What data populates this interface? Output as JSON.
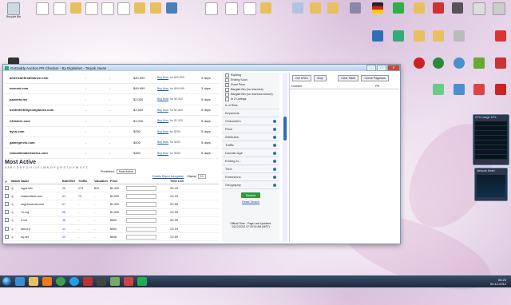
{
  "desktop_icons_top": [
    "Recycle Bin",
    "",
    "",
    "",
    "",
    "",
    "",
    "",
    "",
    "",
    "",
    "",
    "",
    "",
    "",
    "",
    "",
    "",
    "",
    "",
    "",
    "",
    "",
    "",
    "",
    ""
  ],
  "desktop_icons_right": [
    "",
    "",
    "",
    "",
    "",
    "",
    "",
    "",
    "",
    "",
    ""
  ],
  "window": {
    "title": "GoDaddy Auction PR Checker - By Digitalnet - Taryak Javan",
    "min": "–",
    "max": "□",
    "close": "✕"
  },
  "top_rows": [
    {
      "domain": "americanfirstfinance.com",
      "a": "-",
      "b": "-",
      "price": "$40,500",
      "bid": "Buy Now",
      "bidval": "for $40,500",
      "len": "3 days"
    },
    {
      "domain": "moncai.com",
      "a": "-",
      "b": "-",
      "price": "$49,999",
      "bid": "Buy Now",
      "bidval": "for $49,999",
      "len": "3 days"
    },
    {
      "domain": "pandeta.me",
      "a": "-",
      "b": "-",
      "price": "$2,000",
      "bid": "Buy Now",
      "bidval": "for $2,000",
      "len": "5 days"
    },
    {
      "domain": "bestinfertilitycompanies.com",
      "a": "-",
      "b": "-",
      "price": "$1,500",
      "bid": "Buy Now",
      "bidval": "for $1,500",
      "len": "5 days"
    },
    {
      "domain": "234store.com",
      "a": "-",
      "b": "-",
      "price": "$1,000",
      "bid": "Buy Now",
      "bidval": "for $1,000",
      "len": "5 days"
    },
    {
      "domain": "ayco.com",
      "a": "-",
      "b": "-",
      "price": "$250",
      "bid": "Buy Now",
      "bidval": "for $250",
      "len": "5 days"
    },
    {
      "domain": "gamegervis.com",
      "a": "-",
      "b": "-",
      "price": "$400",
      "bid": "Buy Now",
      "bidval": "for $400",
      "len": "5 days"
    },
    {
      "domain": "educationalelectrics.com",
      "a": "-",
      "b": "-",
      "price": "$450",
      "bid": "Buy Now",
      "bidval": "for $450",
      "len": "5 days"
    }
  ],
  "most_active": {
    "title": "Most Active",
    "alphabet": "# A B C D E F G H I J K L M N O P Q R S T U V W X Y Z",
    "pagination": "Enable Reject Navigation",
    "predefined_label": "Predefined:",
    "predefined_value": "Most Active",
    "display_label": "Display",
    "display_value": "10",
    "headers": [
      "Watch",
      "Name",
      "Bid/Offer",
      "Traffic",
      "Valuation",
      "Price",
      "Time Left"
    ],
    "rows": [
      {
        "name": "nqpa.info",
        "bo": "98",
        "tr": "174",
        "va": "$10",
        "pr": "$2,400",
        "tl": "3D 4H"
      },
      {
        "name": "madecriticer.com",
        "bo": "83",
        "tr": "73",
        "va": "-",
        "pr": "$2,050",
        "tl": "1D 2H"
      },
      {
        "name": "ungzhousnas.com",
        "bo": "67",
        "tr": "-",
        "va": "-",
        "pr": "$1,300",
        "tl": "2D 8H"
      },
      {
        "name": "7u.org",
        "bo": "56",
        "tr": "-",
        "va": "-",
        "pr": "$1,500",
        "tl": "1D 5H"
      },
      {
        "name": "3.net",
        "bo": "46",
        "tr": "-",
        "va": "-",
        "pr": "$650",
        "tl": "3D 9H"
      },
      {
        "name": "dfw.org",
        "bo": "42",
        "tr": "-",
        "va": "-",
        "pr": "$950",
        "tl": "1D 1H"
      },
      {
        "name": "zq.net",
        "bo": "39",
        "tr": "-",
        "va": "-",
        "pr": "$548",
        "tl": "1D 6H"
      },
      {
        "name": "8.net",
        "bo": "36",
        "tr": "-",
        "va": "-",
        "pr": "$750",
        "tl": "2D 3H"
      },
      {
        "name": "hollino.com",
        "bo": "35",
        "tr": "81",
        "va": "$132",
        "pr": "$552",
        "tl": "2D 7H"
      },
      {
        "name": "vertuvoal.com",
        "bo": "33",
        "tr": "-",
        "va": "-",
        "pr": "$350",
        "tl": "1D 7H"
      },
      {
        "name": "saa.com",
        "bo": "32",
        "tr": "-",
        "va": "-",
        "pr": "$447",
        "tl": "4D 2H"
      }
    ]
  },
  "filters": {
    "checks": [
      "Expiring",
      "Ending Soon",
      "Fixed Price",
      "Bargain Bin (no reserves)",
      "Bargain Bin (no reserves secure)",
      "In Z Listings"
    ],
    "accordion": [
      "# of Bids",
      "Keywords",
      "Characters",
      "Price",
      "Attributes",
      "Traffic",
      "Domain Age",
      "Ending in...",
      "Time",
      "Extensions",
      "Geography"
    ],
    "search_btn": "Search",
    "reset_link": "Reset Search",
    "official_time": "Official Time - Page Last Updated: 04/12/2012 07:25:34 AM (MST)"
  },
  "right_panel": {
    "buttons": [
      "Get URLs",
      "Stop",
      "Clear Table",
      "Check Pagerank"
    ],
    "col_domain": "Domain",
    "col_pr": "PR"
  },
  "taskbar": {
    "time": "06:23",
    "date": "04.12.2012"
  },
  "gadgets": {
    "cpu_title": "CPU Usage 10%",
    "net_title": "Network Meter"
  }
}
